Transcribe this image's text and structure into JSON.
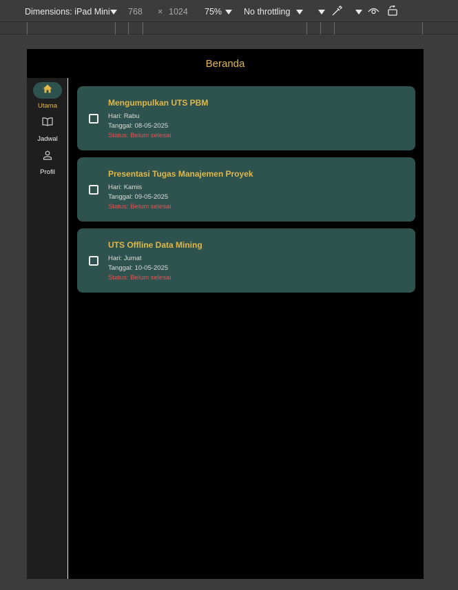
{
  "devtools": {
    "dimensions_label": "Dimensions: iPad Mini",
    "width": "768",
    "times": "×",
    "height": "1024",
    "zoom": "75%",
    "throttling": "No throttling"
  },
  "app": {
    "title": "Beranda",
    "colors": {
      "accent": "#e0b84a",
      "card_bg": "#2e524e",
      "status": "#e05555",
      "background": "#000000"
    },
    "nav": [
      {
        "label": "Utama",
        "icon": "home-icon",
        "active": true
      },
      {
        "label": "Jadwal",
        "icon": "book-icon",
        "active": false
      },
      {
        "label": "Profil",
        "icon": "person-icon",
        "active": false
      }
    ],
    "tasks": [
      {
        "title": "Mengumpulkan UTS PBM",
        "day": "Hari: Rabu",
        "date": "Tanggal: 08-05-2025",
        "status": "Status: Belum selesai",
        "checked": false
      },
      {
        "title": "Presentasi Tugas Manajemen Proyek",
        "day": "Hari: Kamis",
        "date": "Tanggal: 09-05-2025",
        "status": "Status: Belum selesai",
        "checked": false
      },
      {
        "title": "UTS Offline Data Mining",
        "day": "Hari: Jumat",
        "date": "Tanggal: 10-05-2025",
        "status": "Status: Belum selesai",
        "checked": false
      }
    ]
  }
}
